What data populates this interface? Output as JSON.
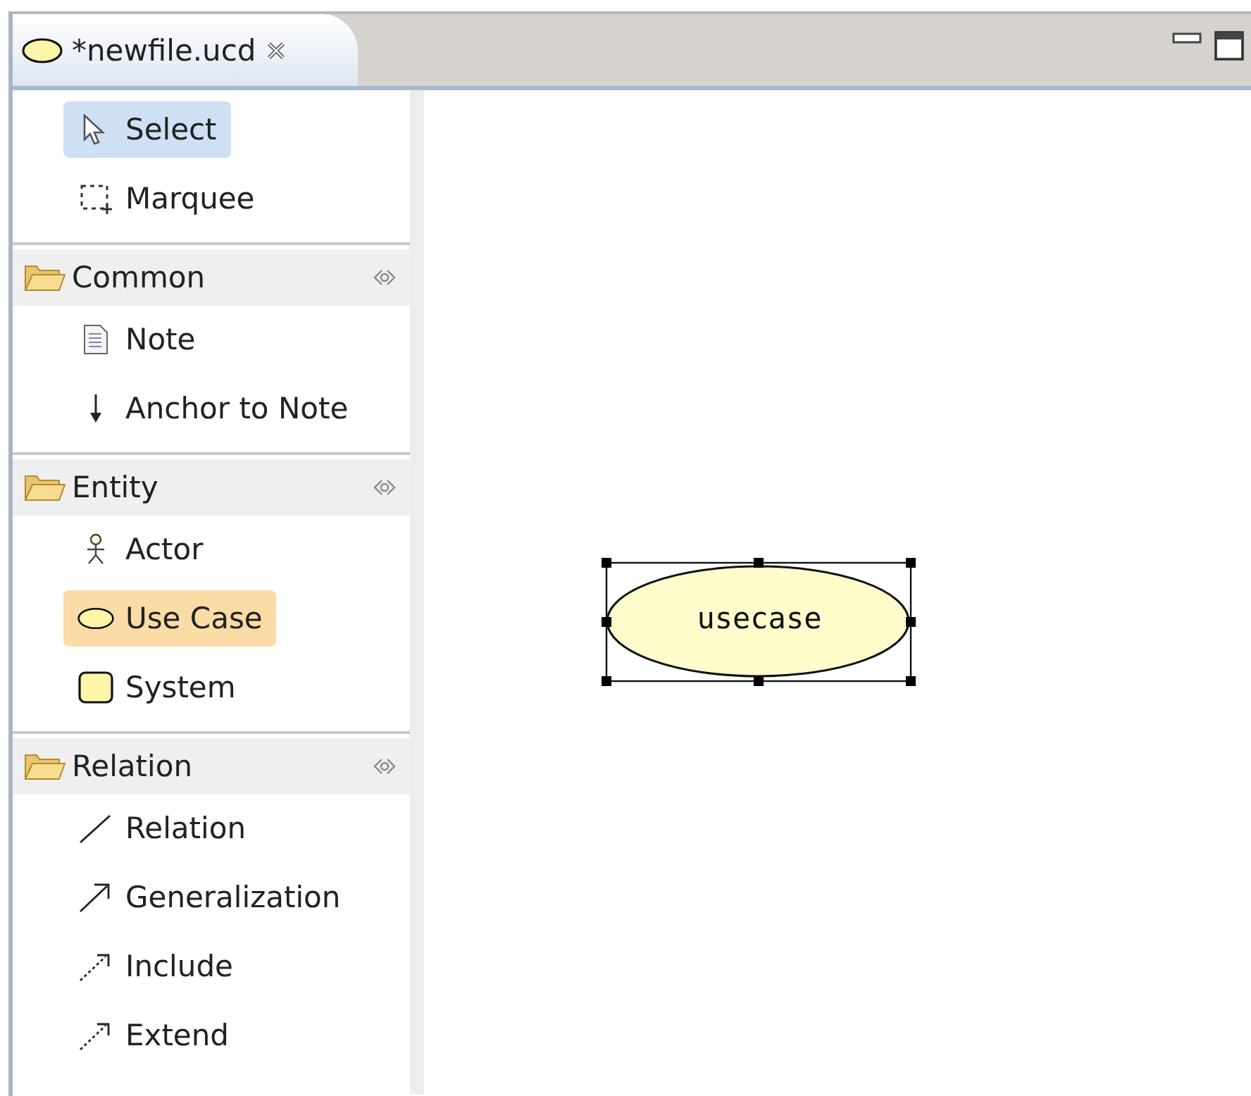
{
  "editor_tab": {
    "title": "*newfile.ucd",
    "selected": true
  },
  "palette": {
    "tools": [
      {
        "label": "Select",
        "kind": "select",
        "selected": true
      },
      {
        "label": "Marquee",
        "kind": "marquee",
        "selected": false
      }
    ],
    "drawers": [
      {
        "title": "Common",
        "items": [
          {
            "label": "Note",
            "kind": "note",
            "selected": false
          },
          {
            "label": "Anchor to Note",
            "kind": "anchor",
            "selected": false
          }
        ]
      },
      {
        "title": "Entity",
        "items": [
          {
            "label": "Actor",
            "kind": "actor",
            "selected": false
          },
          {
            "label": "Use Case",
            "kind": "usecase",
            "selected": true
          },
          {
            "label": "System",
            "kind": "system",
            "selected": false
          }
        ]
      },
      {
        "title": "Relation",
        "items": [
          {
            "label": "Relation",
            "kind": "relation",
            "selected": false
          },
          {
            "label": "Generalization",
            "kind": "generalization",
            "selected": false
          },
          {
            "label": "Include",
            "kind": "include",
            "selected": false
          },
          {
            "label": "Extend",
            "kind": "extend",
            "selected": false
          }
        ]
      }
    ]
  },
  "canvas": {
    "nodes": [
      {
        "kind": "usecase",
        "label": "usecase",
        "selected": true
      }
    ]
  }
}
